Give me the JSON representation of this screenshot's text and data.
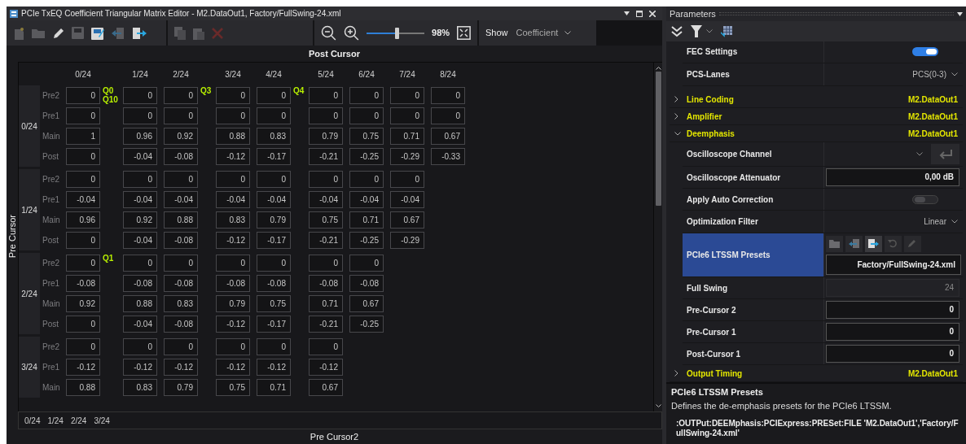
{
  "editor": {
    "title": "PCIe TxEQ Coefficient Triangular Matrix Editor - M2.DataOut1, Factory/FullSwing-24.xml",
    "zoom": {
      "level": 0.52,
      "reading": "98%"
    },
    "show": {
      "label": "Show",
      "value": "Coefficient"
    },
    "x_axis_title": "Post Cursor",
    "y_axis_title": "Pre Cursor",
    "bottom_title": "Pre Cursor2",
    "columns": [
      "0/24",
      "1/24",
      "2/24",
      "3/24",
      "4/24",
      "5/24",
      "6/24",
      "7/24",
      "8/24"
    ],
    "groups": [
      {
        "label": "0/24",
        "markers": {
          "gap_1": [
            "Q0",
            "Q10"
          ],
          "gap_2": [
            "Q3"
          ],
          "gap_3": [
            "Q4"
          ]
        },
        "rows": [
          {
            "name": "Pre2",
            "values": [
              "0",
              "0",
              "0",
              "0",
              "0",
              "0",
              "0",
              "0",
              "0"
            ]
          },
          {
            "name": "Pre1",
            "values": [
              "0",
              "0",
              "0",
              "0",
              "0",
              "0",
              "0",
              "0",
              "0"
            ]
          },
          {
            "name": "Main",
            "values": [
              "1",
              "0.96",
              "0.92",
              "0.88",
              "0.83",
              "0.79",
              "0.75",
              "0.71",
              "0.67"
            ]
          },
          {
            "name": "Post",
            "values": [
              "0",
              "-0.04",
              "-0.08",
              "-0.12",
              "-0.17",
              "-0.21",
              "-0.25",
              "-0.29",
              "-0.33"
            ]
          }
        ]
      },
      {
        "label": "1/24",
        "rows": [
          {
            "name": "Pre2",
            "values": [
              "0",
              "0",
              "0",
              "0",
              "0",
              "0",
              "0",
              "0"
            ]
          },
          {
            "name": "Pre1",
            "values": [
              "-0.04",
              "-0.04",
              "-0.04",
              "-0.04",
              "-0.04",
              "-0.04",
              "-0.04",
              "-0.04"
            ]
          },
          {
            "name": "Main",
            "values": [
              "0.96",
              "0.92",
              "0.88",
              "0.83",
              "0.79",
              "0.75",
              "0.71",
              "0.67"
            ]
          },
          {
            "name": "Post",
            "values": [
              "0",
              "-0.04",
              "-0.08",
              "-0.12",
              "-0.17",
              "-0.21",
              "-0.25",
              "-0.29"
            ]
          }
        ]
      },
      {
        "label": "2/24",
        "markers": {
          "gap_1": [
            "Q1"
          ]
        },
        "rows": [
          {
            "name": "Pre2",
            "values": [
              "0",
              "0",
              "0",
              "0",
              "0",
              "0",
              "0"
            ]
          },
          {
            "name": "Pre1",
            "values": [
              "-0.08",
              "-0.08",
              "-0.08",
              "-0.08",
              "-0.08",
              "-0.08",
              "-0.08"
            ]
          },
          {
            "name": "Main",
            "values": [
              "0.92",
              "0.88",
              "0.83",
              "0.79",
              "0.75",
              "0.71",
              "0.67"
            ]
          },
          {
            "name": "Post",
            "values": [
              "0",
              "-0.04",
              "-0.08",
              "-0.12",
              "-0.17",
              "-0.21",
              "-0.25"
            ]
          }
        ]
      },
      {
        "label": "3/24",
        "rows": [
          {
            "name": "Pre2",
            "values": [
              "0",
              "0",
              "0",
              "0",
              "0",
              "0"
            ]
          },
          {
            "name": "Pre1",
            "values": [
              "-0.12",
              "-0.12",
              "-0.12",
              "-0.12",
              "-0.12",
              "-0.12"
            ]
          },
          {
            "name": "Main",
            "values": [
              "0.88",
              "0.83",
              "0.79",
              "0.75",
              "0.71",
              "0.67"
            ]
          }
        ]
      }
    ],
    "y_labels": [
      "0/24",
      "1/24",
      "2/24",
      "3/24"
    ]
  },
  "parameters": {
    "title": "Parameters",
    "rows": [
      {
        "kind": "toggle",
        "label": "FEC Settings",
        "on": true,
        "selected": false
      },
      {
        "kind": "dropdown",
        "label": "PCS-Lanes",
        "value": "PCS(0-3)",
        "selected": false
      },
      {
        "kind": "section",
        "label": "Line Coding",
        "value": "M2.DataOut1",
        "expanded": false,
        "selected": false
      },
      {
        "kind": "section",
        "label": "Amplifier",
        "value": "M2.DataOut1",
        "expanded": false,
        "selected": false
      },
      {
        "kind": "section",
        "label": "Deemphasis",
        "value": "M2.DataOut1",
        "expanded": true,
        "selected": false
      },
      {
        "kind": "channel",
        "label": "Oscilloscope Channel",
        "selected": false
      },
      {
        "kind": "input",
        "label": "Oscilloscope Attenuator",
        "value": "0,00 dB",
        "disabled": false,
        "selected": false
      },
      {
        "kind": "toggle",
        "label": "Apply Auto Correction",
        "on": false,
        "selected": false
      },
      {
        "kind": "dropdown",
        "label": "Optimization Filter",
        "value": "Linear",
        "selected": false
      },
      {
        "kind": "preset",
        "label": "PCIe6 LTSSM Presets",
        "value": "Factory/FullSwing-24.xml",
        "selected": true
      },
      {
        "kind": "input",
        "label": "Full Swing",
        "value": "24",
        "disabled": true,
        "selected": false
      },
      {
        "kind": "input",
        "label": "Pre-Cursor 2",
        "value": "0",
        "disabled": false,
        "selected": false
      },
      {
        "kind": "input",
        "label": "Pre-Cursor 1",
        "value": "0",
        "disabled": false,
        "selected": false
      },
      {
        "kind": "input",
        "label": "Post-Cursor 1",
        "value": "0",
        "disabled": false,
        "selected": false
      },
      {
        "kind": "section",
        "label": "Output Timing",
        "value": "M2.DataOut1",
        "expanded": false,
        "selected": false
      }
    ],
    "help": {
      "title": "PCIe6 LTSSM Presets",
      "description": "Defines the de-emphasis presets for the PCIe6 LTSSM.",
      "command": ":OUTPut:DEEMphasis:PCIExpress:PRESet:FILE 'M2.DataOut1','Factory/FullSwing-24.xml'"
    }
  }
}
